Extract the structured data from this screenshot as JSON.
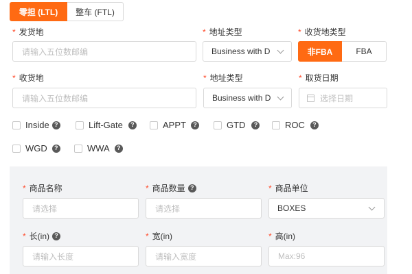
{
  "tabs": {
    "ltl": "零担 (LTL)",
    "ftl": "整车 (FTL)"
  },
  "origin": {
    "label": "发货地",
    "placeholder": "请输入五位数邮编",
    "address_type_label": "地址类型",
    "address_type_value": "Business with D"
  },
  "destination_type": {
    "label": "收货地类型",
    "options": [
      "非FBA",
      "FBA"
    ],
    "selected": "非FBA"
  },
  "destination": {
    "label": "收货地",
    "placeholder": "请输入五位数邮编",
    "address_type_label": "地址类型",
    "address_type_value": "Business with D"
  },
  "pickup_date": {
    "label": "取货日期",
    "placeholder": "选择日期"
  },
  "services": [
    {
      "label": "Inside",
      "checked": false
    },
    {
      "label": "Lift-Gate",
      "checked": false
    },
    {
      "label": "APPT",
      "checked": false
    },
    {
      "label": "GTD",
      "checked": false
    },
    {
      "label": "ROC",
      "checked": false
    },
    {
      "label": "WGD",
      "checked": false
    },
    {
      "label": "WWA",
      "checked": false
    }
  ],
  "product": {
    "name_label": "商品名称",
    "name_placeholder": "请选择",
    "qty_label": "商品数量",
    "qty_placeholder": "请选择",
    "unit_label": "商品单位",
    "unit_value": "BOXES",
    "length_label": "长(in)",
    "length_placeholder": "请输入长度",
    "width_label": "宽(in)",
    "width_placeholder": "请输入宽度",
    "height_label": "高(in)",
    "height_placeholder": "Max:96"
  },
  "required_mark": "*",
  "help_glyph": "?",
  "colors": {
    "accent": "#ff6a13",
    "required": "#ff4d2e",
    "panel_bg": "#f2f3f5",
    "border": "#d9d9d9",
    "placeholder": "#bfbfbf"
  }
}
